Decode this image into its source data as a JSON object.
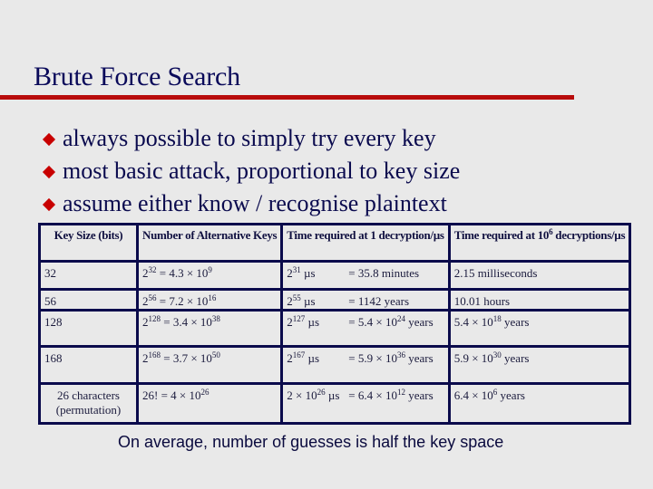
{
  "slide": {
    "title": "Brute Force Search",
    "colors": {
      "title": "#0a0a5a",
      "rule": "#b80c0c",
      "bullet": "#c80000",
      "table_border": "#0b0b4c",
      "background": "#e9e9e9"
    },
    "bullets": [
      "always possible to simply try every key",
      "most basic attack, proportional to key size",
      "assume either know / recognise plaintext"
    ],
    "footer": "On average, number of guesses is half the key space"
  },
  "table": {
    "headers": [
      [
        {
          "t": "Key Size (bits)"
        }
      ],
      [
        {
          "t": "Number of Alternative Keys"
        }
      ],
      [
        {
          "t": "Time required at 1 decryption/µs"
        }
      ],
      [
        {
          "t": "Time required at 10"
        },
        {
          "sup": "6"
        },
        {
          "t": " decryptions/µs"
        }
      ]
    ],
    "rows": [
      {
        "key_size": "32",
        "alternatives": [
          {
            "t": "2"
          },
          {
            "sup": "32"
          },
          {
            "t": " = 4.3 × 10"
          },
          {
            "sup": "9"
          }
        ],
        "time_us": [
          {
            "t": "2"
          },
          {
            "sup": "31"
          },
          {
            "t": " µs"
          }
        ],
        "time_value": [
          {
            "t": "= 35.8 minutes"
          }
        ],
        "time_fast": [
          {
            "t": "2.15 milliseconds"
          }
        ]
      },
      {
        "key_size": "56",
        "alternatives": [
          {
            "t": "2"
          },
          {
            "sup": "56"
          },
          {
            "t": " = 7.2 × 10"
          },
          {
            "sup": "16"
          }
        ],
        "time_us": [
          {
            "t": "2"
          },
          {
            "sup": "55"
          },
          {
            "t": " µs"
          }
        ],
        "time_value": [
          {
            "t": "= 1142 years"
          }
        ],
        "time_fast": [
          {
            "t": "10.01 hours"
          }
        ]
      },
      {
        "key_size": "128",
        "alternatives": [
          {
            "t": "2"
          },
          {
            "sup": "128"
          },
          {
            "t": " = 3.4 × 10"
          },
          {
            "sup": "38"
          }
        ],
        "time_us": [
          {
            "t": "2"
          },
          {
            "sup": "127"
          },
          {
            "t": " µs"
          }
        ],
        "time_value": [
          {
            "t": "= 5.4 × 10"
          },
          {
            "sup": "24"
          },
          {
            "t": " years"
          }
        ],
        "time_fast": [
          {
            "t": "5.4 × 10"
          },
          {
            "sup": "18"
          },
          {
            "t": " years"
          }
        ]
      },
      {
        "key_size": "168",
        "alternatives": [
          {
            "t": "2"
          },
          {
            "sup": "168"
          },
          {
            "t": " = 3.7 × 10"
          },
          {
            "sup": "50"
          }
        ],
        "time_us": [
          {
            "t": "2"
          },
          {
            "sup": "167"
          },
          {
            "t": " µs"
          }
        ],
        "time_value": [
          {
            "t": "= 5.9 × 10"
          },
          {
            "sup": "36"
          },
          {
            "t": " years"
          }
        ],
        "time_fast": [
          {
            "t": "5.9 × 10"
          },
          {
            "sup": "30"
          },
          {
            "t": " years"
          }
        ]
      },
      {
        "key_size": "26 characters (permutation)",
        "alternatives": [
          {
            "t": "26! = 4 × 10"
          },
          {
            "sup": "26"
          }
        ],
        "time_us": [
          {
            "t": "2 × 10"
          },
          {
            "sup": "26"
          },
          {
            "t": " µs"
          }
        ],
        "time_value": [
          {
            "t": "= 6.4 × 10"
          },
          {
            "sup": "12"
          },
          {
            "t": " years"
          }
        ],
        "time_fast": [
          {
            "t": "6.4 × 10"
          },
          {
            "sup": "6"
          },
          {
            "t": " years"
          }
        ]
      }
    ]
  }
}
